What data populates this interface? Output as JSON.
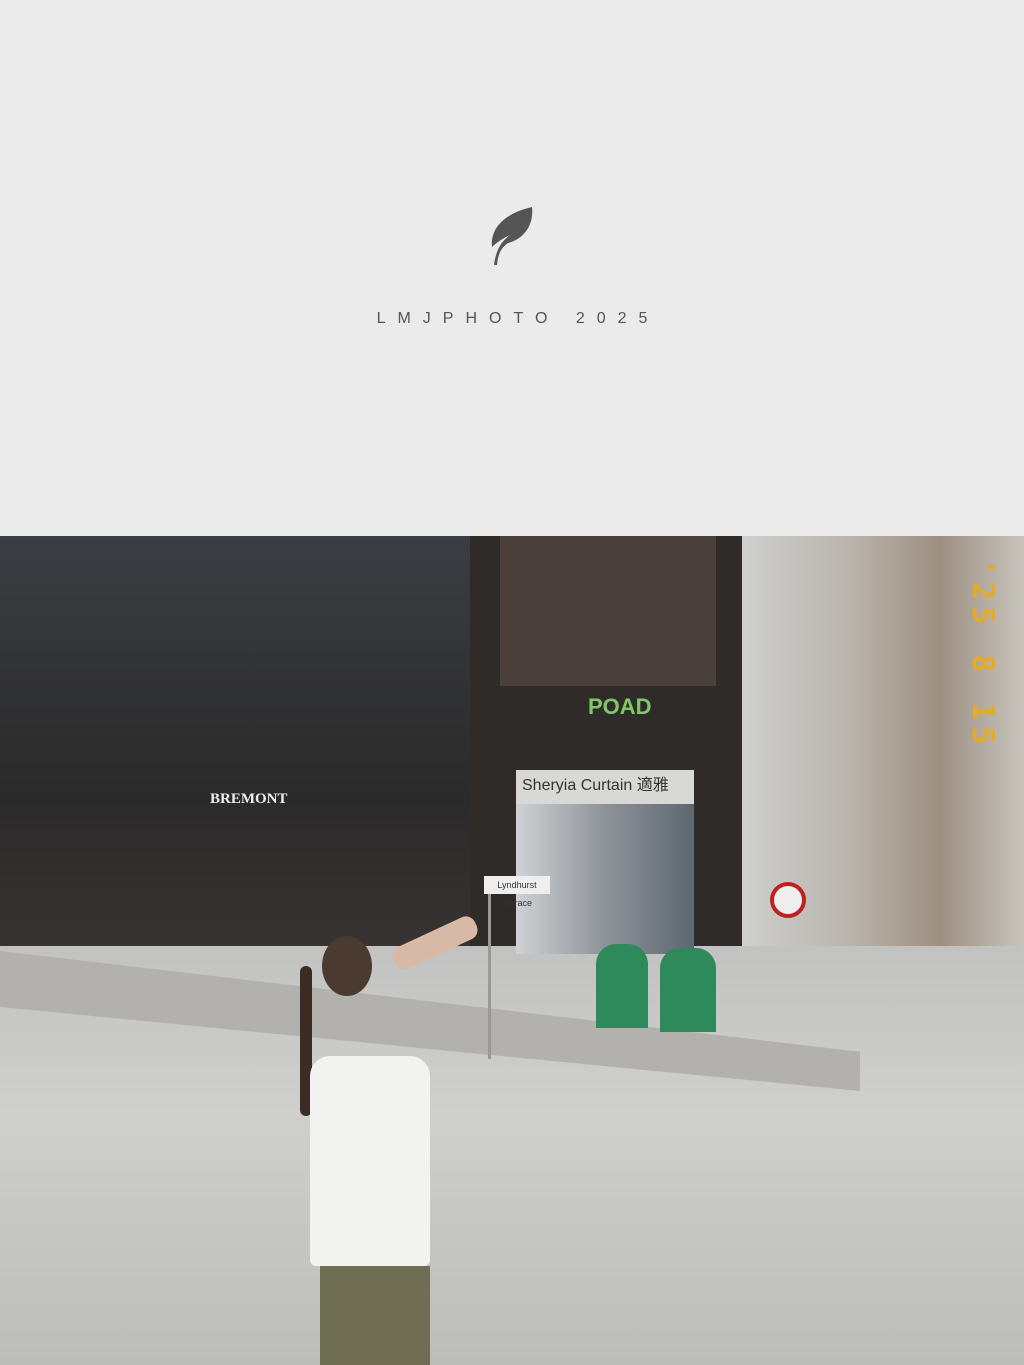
{
  "header": {
    "brand_text": "LMJPHOTO 2025",
    "logo_icon": "leaf-icon"
  },
  "photo": {
    "date_stamp": "'25 8 15",
    "signs": {
      "shop_top": "POAD",
      "shop_name": "Sheryia Curtain 適雅",
      "brand": "BREMONT",
      "street": "Lyndhurst Terrace"
    }
  },
  "colors": {
    "background": "#ebebeb",
    "brand_text": "#555555",
    "stamp": "#e2ac2a"
  }
}
